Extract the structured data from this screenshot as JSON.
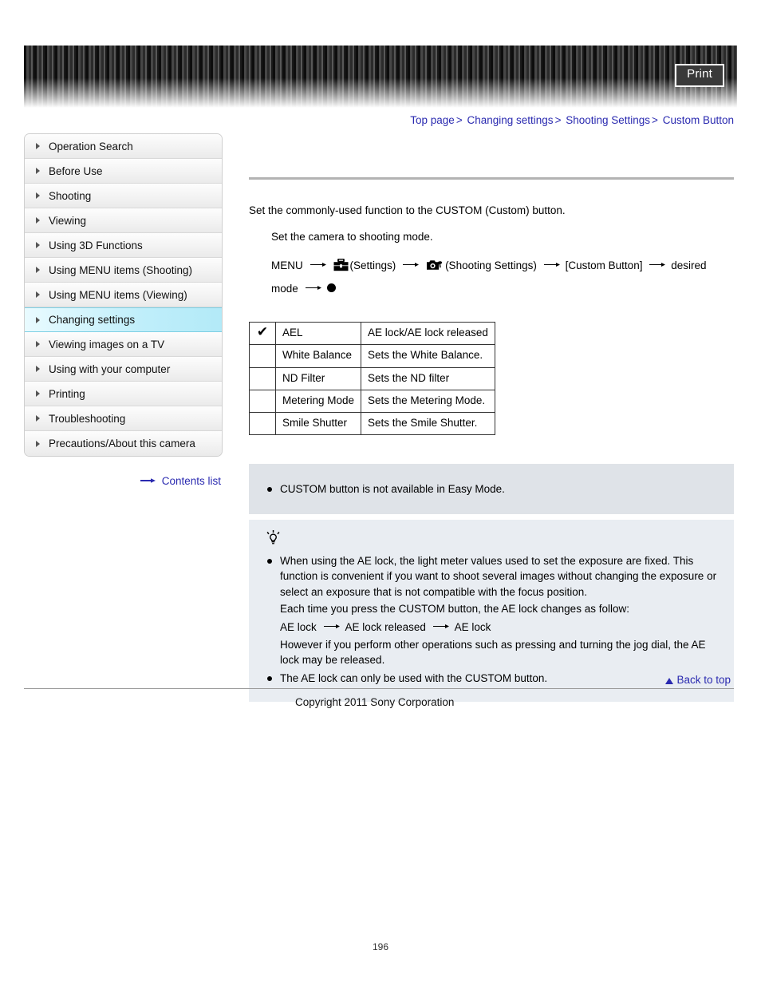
{
  "header": {
    "print_label": "Print"
  },
  "breadcrumb": {
    "items": [
      "Top page",
      "Changing settings",
      "Shooting Settings",
      "Custom Button"
    ],
    "separator": ">"
  },
  "sidebar": {
    "items": [
      {
        "label": "Operation Search",
        "active": false
      },
      {
        "label": "Before Use",
        "active": false
      },
      {
        "label": "Shooting",
        "active": false
      },
      {
        "label": "Viewing",
        "active": false
      },
      {
        "label": "Using 3D Functions",
        "active": false
      },
      {
        "label": "Using MENU items (Shooting)",
        "active": false
      },
      {
        "label": "Using MENU items (Viewing)",
        "active": false
      },
      {
        "label": "Changing settings",
        "active": true
      },
      {
        "label": "Viewing images on a TV",
        "active": false
      },
      {
        "label": "Using with your computer",
        "active": false
      },
      {
        "label": "Printing",
        "active": false
      },
      {
        "label": "Troubleshooting",
        "active": false
      },
      {
        "label": "Precautions/About this camera",
        "active": false
      }
    ],
    "contents_link": "Contents list"
  },
  "main": {
    "intro": "Set the commonly-used function to the CUSTOM (Custom) button.",
    "step": "Set the camera to shooting mode.",
    "menu_path": {
      "start": "MENU",
      "settings_label": "(Settings)",
      "shooting_settings_label": "(Shooting Settings)",
      "custom_button_label": "[Custom Button]",
      "desired_mode": "desired mode",
      "arrow": "→"
    },
    "table": {
      "rows": [
        {
          "checked": "✔",
          "option": "AEL",
          "description": "AE lock/AE lock released"
        },
        {
          "checked": "",
          "option": "White Balance",
          "description": "Sets the White Balance."
        },
        {
          "checked": "",
          "option": "ND Filter",
          "description": "Sets the ND filter"
        },
        {
          "checked": "",
          "option": "Metering Mode",
          "description": "Sets the Metering Mode."
        },
        {
          "checked": "",
          "option": "Smile Shutter",
          "description": "Sets the Smile Shutter."
        }
      ]
    },
    "note": {
      "items": [
        "CUSTOM button is not available in Easy Mode."
      ]
    },
    "hint": {
      "item1": "When using the AE lock, the light meter values used to set the exposure are fixed. This function is convenient if you want to shoot several images without changing the exposure or select an exposure that is not compatible with the focus position.",
      "item1_line2": "Each time you press the CUSTOM button, the AE lock changes as follow:",
      "item1_flow_a": "AE lock",
      "item1_flow_b": "AE lock released",
      "item1_flow_c": "AE lock",
      "item1_line3": "However if you perform other operations such as pressing and turning the jog dial, the AE lock may be released.",
      "item2": "The AE lock can only be used with the CUSTOM button."
    }
  },
  "footer": {
    "back_to_top": "Back to top",
    "copyright": "Copyright 2011 Sony Corporation",
    "page_number": "196"
  },
  "colors": {
    "link": "#2a2ab0",
    "active_nav": "#b3eaf8",
    "note_bg": "#dfe3e8",
    "hint_bg": "#e9edf2"
  }
}
